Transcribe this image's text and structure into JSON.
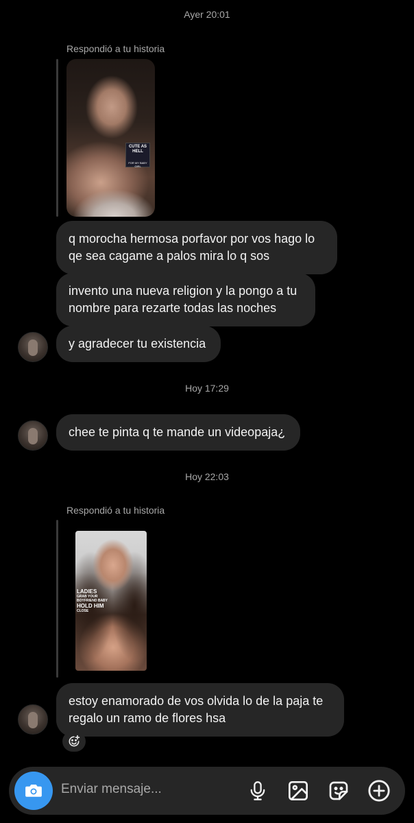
{
  "thread": {
    "timestamps": [
      "Ayer 20:01",
      "Hoy 17:29",
      "Hoy 22:03"
    ],
    "story_reply_label": "Respondió a tu historia",
    "story1": {
      "badge_title": "CUTE AS HELL",
      "badge_caption": "FOR MY BABY GIRL"
    },
    "story2": {
      "overlay_line1": "LADIES",
      "overlay_line2": "GRAB YOUR",
      "overlay_line3": "BOYFRIEND BABY",
      "overlay_line4": "HOLD HIM",
      "overlay_line5": "CLOSE"
    },
    "messages": [
      "q morocha hermosa porfavor por vos hago lo qe sea cagame a palos mira lo q sos",
      "invento una nueva religion y la pongo a tu nombre para rezarte todas las noches",
      "y agradecer tu existencia",
      "chee te pinta q te mande un videopaja¿",
      "estoy enamorado de vos olvida lo de la paja te regalo un ramo de flores hsa"
    ]
  },
  "composer": {
    "placeholder": "Enviar mensaje...",
    "accent_color": "#3797f0",
    "icons": [
      "camera-icon",
      "microphone-icon",
      "gallery-icon",
      "sticker-icon",
      "plus-icon"
    ]
  }
}
